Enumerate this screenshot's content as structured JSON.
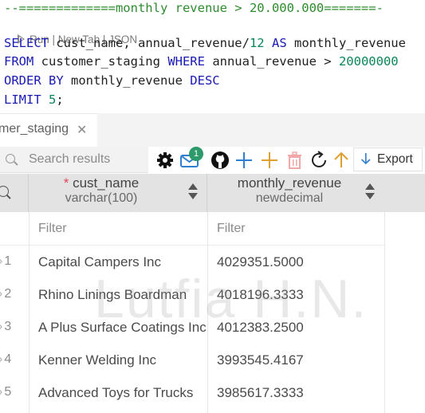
{
  "editor": {
    "comment_line": "--=============monthly revenue > 20.000.000=======-",
    "codelens": {
      "run": "Run",
      "sep1": " | ",
      "new_tab": "New Tab",
      "sep2": " | ",
      "json": "JSON"
    },
    "line1": {
      "kw1": "SELECT",
      "t1": " cust_name, annual_revenue/",
      "n1": "12",
      "t2": " ",
      "kw2": "AS",
      "t3": " monthly_revenue"
    },
    "line2": {
      "kw1": "FROM",
      "t1": " customer_staging ",
      "kw2": "WHERE",
      "t2": " annual_revenue > ",
      "n1": "20000000"
    },
    "line3": {
      "kw1": "ORDER BY",
      "t1": " monthly_revenue ",
      "kw2": "DESC"
    },
    "line4": {
      "kw1": "LIMIT",
      "t1": " ",
      "n1": "5",
      "t2": ";"
    }
  },
  "tab": {
    "label": "mer_staging",
    "close": "✕"
  },
  "toolbar": {
    "search_placeholder": "Search results",
    "badge_count": "1",
    "export_label": "Export"
  },
  "grid": {
    "columns": [
      {
        "required_mark": "* ",
        "name": "cust_name",
        "type": "varchar(100)"
      },
      {
        "required_mark": "",
        "name": "monthly_revenue",
        "type": "newdecimal"
      }
    ],
    "filter_placeholder": "Filter",
    "rows": [
      {
        "num": "1",
        "cust_name": "Capital Campers Inc",
        "monthly_revenue": "4029351.5000"
      },
      {
        "num": "2",
        "cust_name": "Rhino Linings Boardman",
        "monthly_revenue": "4018196.3333"
      },
      {
        "num": "3",
        "cust_name": "A Plus Surface Coatings Inc",
        "monthly_revenue": "4012383.2500"
      },
      {
        "num": "4",
        "cust_name": "Kenner Welding Inc",
        "monthly_revenue": "3993545.4167"
      },
      {
        "num": "5",
        "cust_name": "Advanced Toys for Trucks",
        "monthly_revenue": "3985617.3333"
      }
    ]
  },
  "watermark": "Lutfia H.N.",
  "colors": {
    "keyword": "#1a1ab5",
    "comment": "#2e8b2e",
    "number": "#098658",
    "toolbar_blue": "#2f7fd1",
    "toolbar_orange": "#e0a030",
    "badge_green": "#2e9a6b"
  },
  "icons": [
    "play-icon",
    "search-icon",
    "gear-icon",
    "mail-icon",
    "github-icon",
    "add-row-icon",
    "add-column-icon",
    "trash-icon",
    "refresh-icon",
    "arrow-up-icon",
    "export-arrow-icon",
    "sort-icon",
    "close-icon"
  ]
}
